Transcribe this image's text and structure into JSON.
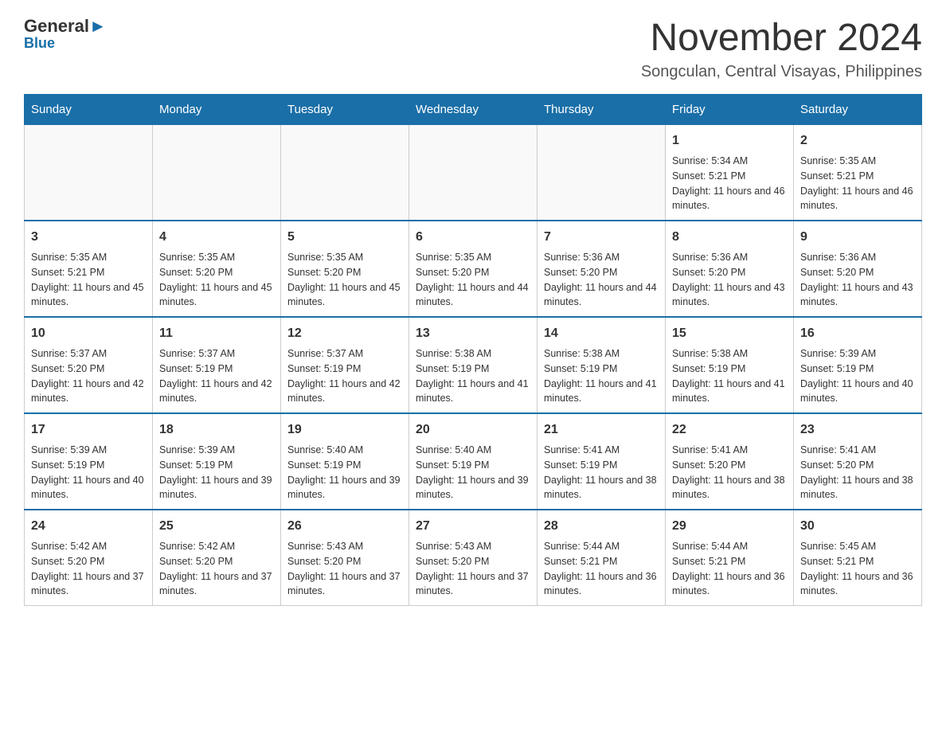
{
  "header": {
    "logo": {
      "general": "General",
      "blue": "Blue"
    },
    "title": "November 2024",
    "location": "Songculan, Central Visayas, Philippines"
  },
  "weekdays": [
    "Sunday",
    "Monday",
    "Tuesday",
    "Wednesday",
    "Thursday",
    "Friday",
    "Saturday"
  ],
  "weeks": [
    [
      {
        "day": "",
        "info": ""
      },
      {
        "day": "",
        "info": ""
      },
      {
        "day": "",
        "info": ""
      },
      {
        "day": "",
        "info": ""
      },
      {
        "day": "",
        "info": ""
      },
      {
        "day": "1",
        "info": "Sunrise: 5:34 AM\nSunset: 5:21 PM\nDaylight: 11 hours and 46 minutes."
      },
      {
        "day": "2",
        "info": "Sunrise: 5:35 AM\nSunset: 5:21 PM\nDaylight: 11 hours and 46 minutes."
      }
    ],
    [
      {
        "day": "3",
        "info": "Sunrise: 5:35 AM\nSunset: 5:21 PM\nDaylight: 11 hours and 45 minutes."
      },
      {
        "day": "4",
        "info": "Sunrise: 5:35 AM\nSunset: 5:20 PM\nDaylight: 11 hours and 45 minutes."
      },
      {
        "day": "5",
        "info": "Sunrise: 5:35 AM\nSunset: 5:20 PM\nDaylight: 11 hours and 45 minutes."
      },
      {
        "day": "6",
        "info": "Sunrise: 5:35 AM\nSunset: 5:20 PM\nDaylight: 11 hours and 44 minutes."
      },
      {
        "day": "7",
        "info": "Sunrise: 5:36 AM\nSunset: 5:20 PM\nDaylight: 11 hours and 44 minutes."
      },
      {
        "day": "8",
        "info": "Sunrise: 5:36 AM\nSunset: 5:20 PM\nDaylight: 11 hours and 43 minutes."
      },
      {
        "day": "9",
        "info": "Sunrise: 5:36 AM\nSunset: 5:20 PM\nDaylight: 11 hours and 43 minutes."
      }
    ],
    [
      {
        "day": "10",
        "info": "Sunrise: 5:37 AM\nSunset: 5:20 PM\nDaylight: 11 hours and 42 minutes."
      },
      {
        "day": "11",
        "info": "Sunrise: 5:37 AM\nSunset: 5:19 PM\nDaylight: 11 hours and 42 minutes."
      },
      {
        "day": "12",
        "info": "Sunrise: 5:37 AM\nSunset: 5:19 PM\nDaylight: 11 hours and 42 minutes."
      },
      {
        "day": "13",
        "info": "Sunrise: 5:38 AM\nSunset: 5:19 PM\nDaylight: 11 hours and 41 minutes."
      },
      {
        "day": "14",
        "info": "Sunrise: 5:38 AM\nSunset: 5:19 PM\nDaylight: 11 hours and 41 minutes."
      },
      {
        "day": "15",
        "info": "Sunrise: 5:38 AM\nSunset: 5:19 PM\nDaylight: 11 hours and 41 minutes."
      },
      {
        "day": "16",
        "info": "Sunrise: 5:39 AM\nSunset: 5:19 PM\nDaylight: 11 hours and 40 minutes."
      }
    ],
    [
      {
        "day": "17",
        "info": "Sunrise: 5:39 AM\nSunset: 5:19 PM\nDaylight: 11 hours and 40 minutes."
      },
      {
        "day": "18",
        "info": "Sunrise: 5:39 AM\nSunset: 5:19 PM\nDaylight: 11 hours and 39 minutes."
      },
      {
        "day": "19",
        "info": "Sunrise: 5:40 AM\nSunset: 5:19 PM\nDaylight: 11 hours and 39 minutes."
      },
      {
        "day": "20",
        "info": "Sunrise: 5:40 AM\nSunset: 5:19 PM\nDaylight: 11 hours and 39 minutes."
      },
      {
        "day": "21",
        "info": "Sunrise: 5:41 AM\nSunset: 5:19 PM\nDaylight: 11 hours and 38 minutes."
      },
      {
        "day": "22",
        "info": "Sunrise: 5:41 AM\nSunset: 5:20 PM\nDaylight: 11 hours and 38 minutes."
      },
      {
        "day": "23",
        "info": "Sunrise: 5:41 AM\nSunset: 5:20 PM\nDaylight: 11 hours and 38 minutes."
      }
    ],
    [
      {
        "day": "24",
        "info": "Sunrise: 5:42 AM\nSunset: 5:20 PM\nDaylight: 11 hours and 37 minutes."
      },
      {
        "day": "25",
        "info": "Sunrise: 5:42 AM\nSunset: 5:20 PM\nDaylight: 11 hours and 37 minutes."
      },
      {
        "day": "26",
        "info": "Sunrise: 5:43 AM\nSunset: 5:20 PM\nDaylight: 11 hours and 37 minutes."
      },
      {
        "day": "27",
        "info": "Sunrise: 5:43 AM\nSunset: 5:20 PM\nDaylight: 11 hours and 37 minutes."
      },
      {
        "day": "28",
        "info": "Sunrise: 5:44 AM\nSunset: 5:21 PM\nDaylight: 11 hours and 36 minutes."
      },
      {
        "day": "29",
        "info": "Sunrise: 5:44 AM\nSunset: 5:21 PM\nDaylight: 11 hours and 36 minutes."
      },
      {
        "day": "30",
        "info": "Sunrise: 5:45 AM\nSunset: 5:21 PM\nDaylight: 11 hours and 36 minutes."
      }
    ]
  ]
}
